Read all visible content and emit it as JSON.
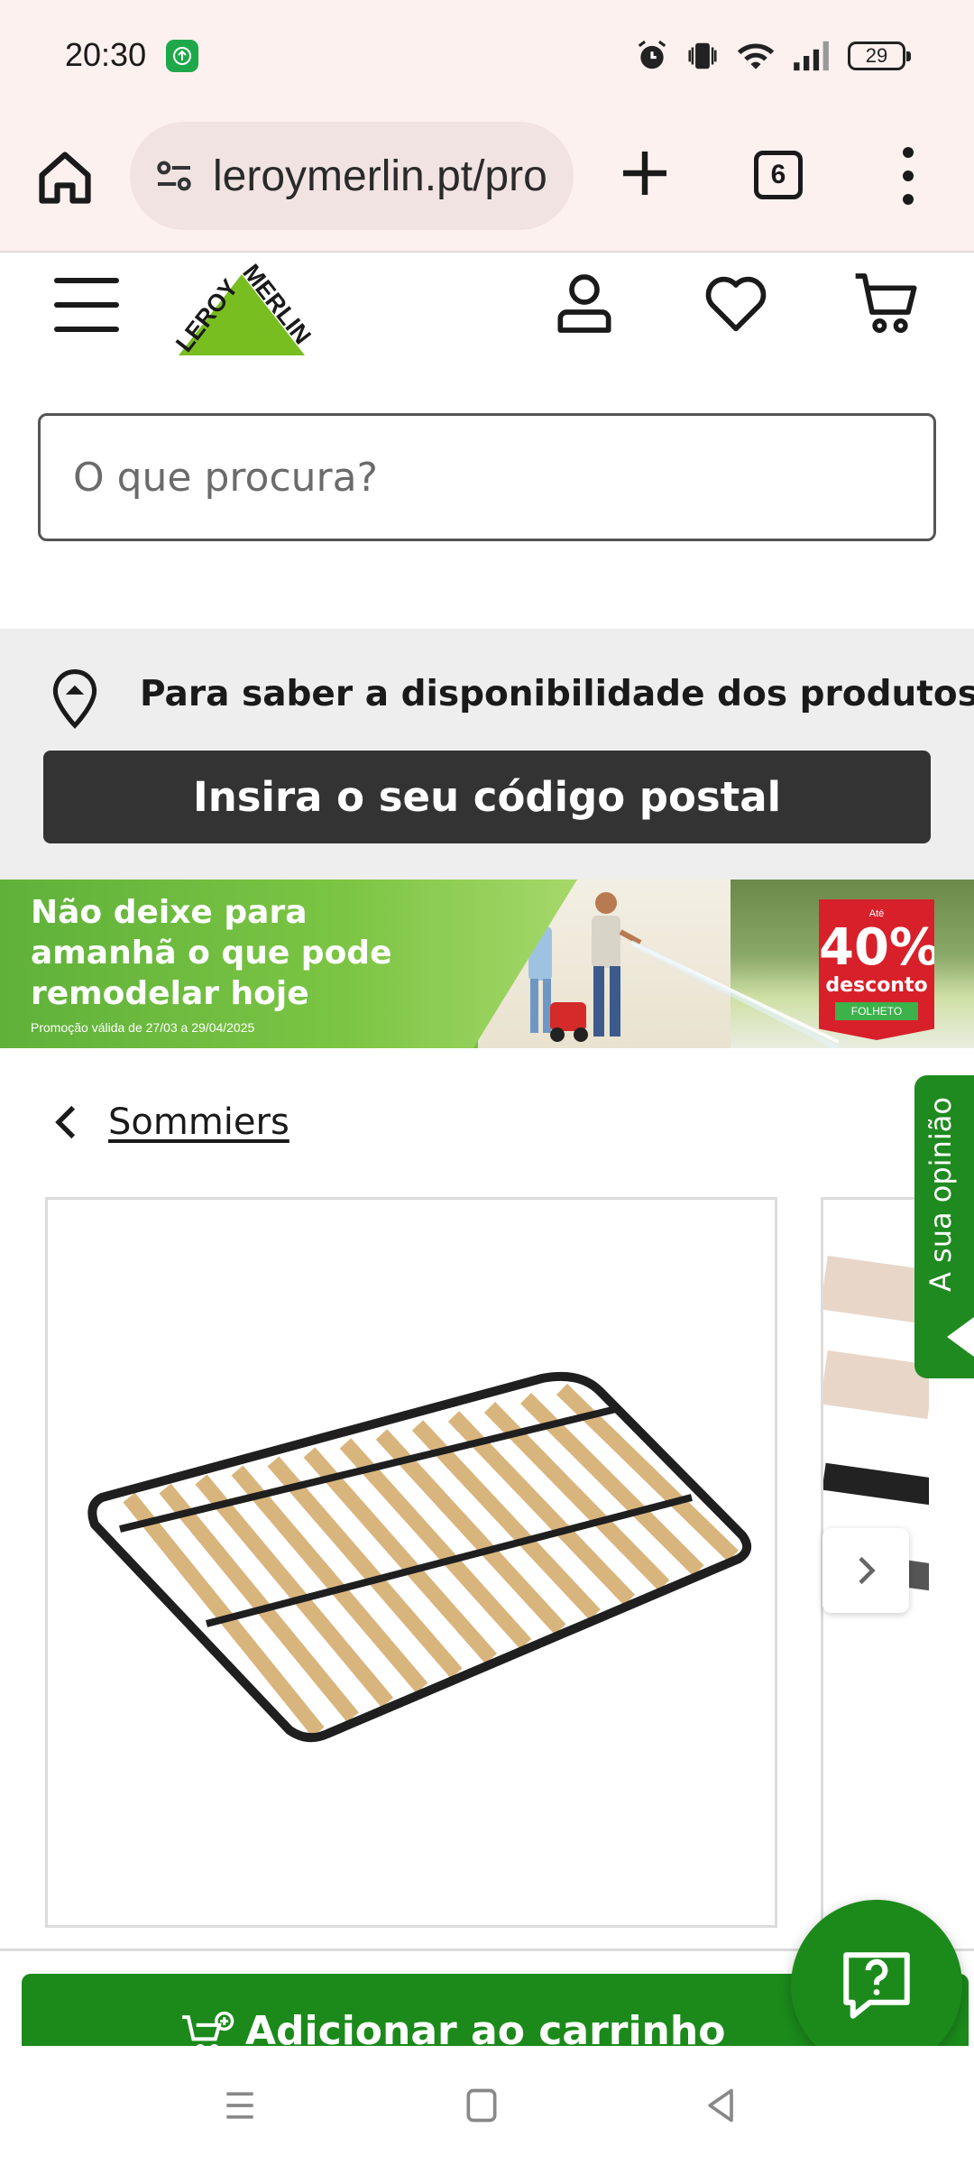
{
  "status_bar": {
    "time": "20:30",
    "battery": "29",
    "icons": [
      "upload-app-icon",
      "alarm-icon",
      "vibrate-icon",
      "wifi-icon",
      "signal-icon",
      "battery-icon"
    ]
  },
  "browser": {
    "url": "leroymerlin.pt/pro",
    "tab_count": "6"
  },
  "header": {
    "logo_text": "LEROY MERLIN",
    "icons": [
      "menu-icon",
      "account-icon",
      "favorites-icon",
      "cart-icon"
    ]
  },
  "search": {
    "placeholder": "O que procura?"
  },
  "availability": {
    "text": "Para saber a disponibilidade dos produtos",
    "button": "Insira o seu código postal"
  },
  "promo": {
    "title": "Não deixe para amanhã o que pode remodelar hoje",
    "validity": "Promoção válida de 27/03 a 29/04/2025",
    "badge_prefix": "Até",
    "badge_value": "40%",
    "badge_label": "desconto",
    "badge_tag": "FOLHETO"
  },
  "breadcrumb": {
    "label": "Sommiers"
  },
  "feedback": {
    "label": "A sua opinião"
  },
  "product": {
    "add_to_cart": "Adicionar ao carrinho"
  },
  "colors": {
    "brand_green": "#78be20",
    "button_green": "#1b8a1b",
    "dark_button": "#333333",
    "browser_bg": "#fdf1ef"
  }
}
